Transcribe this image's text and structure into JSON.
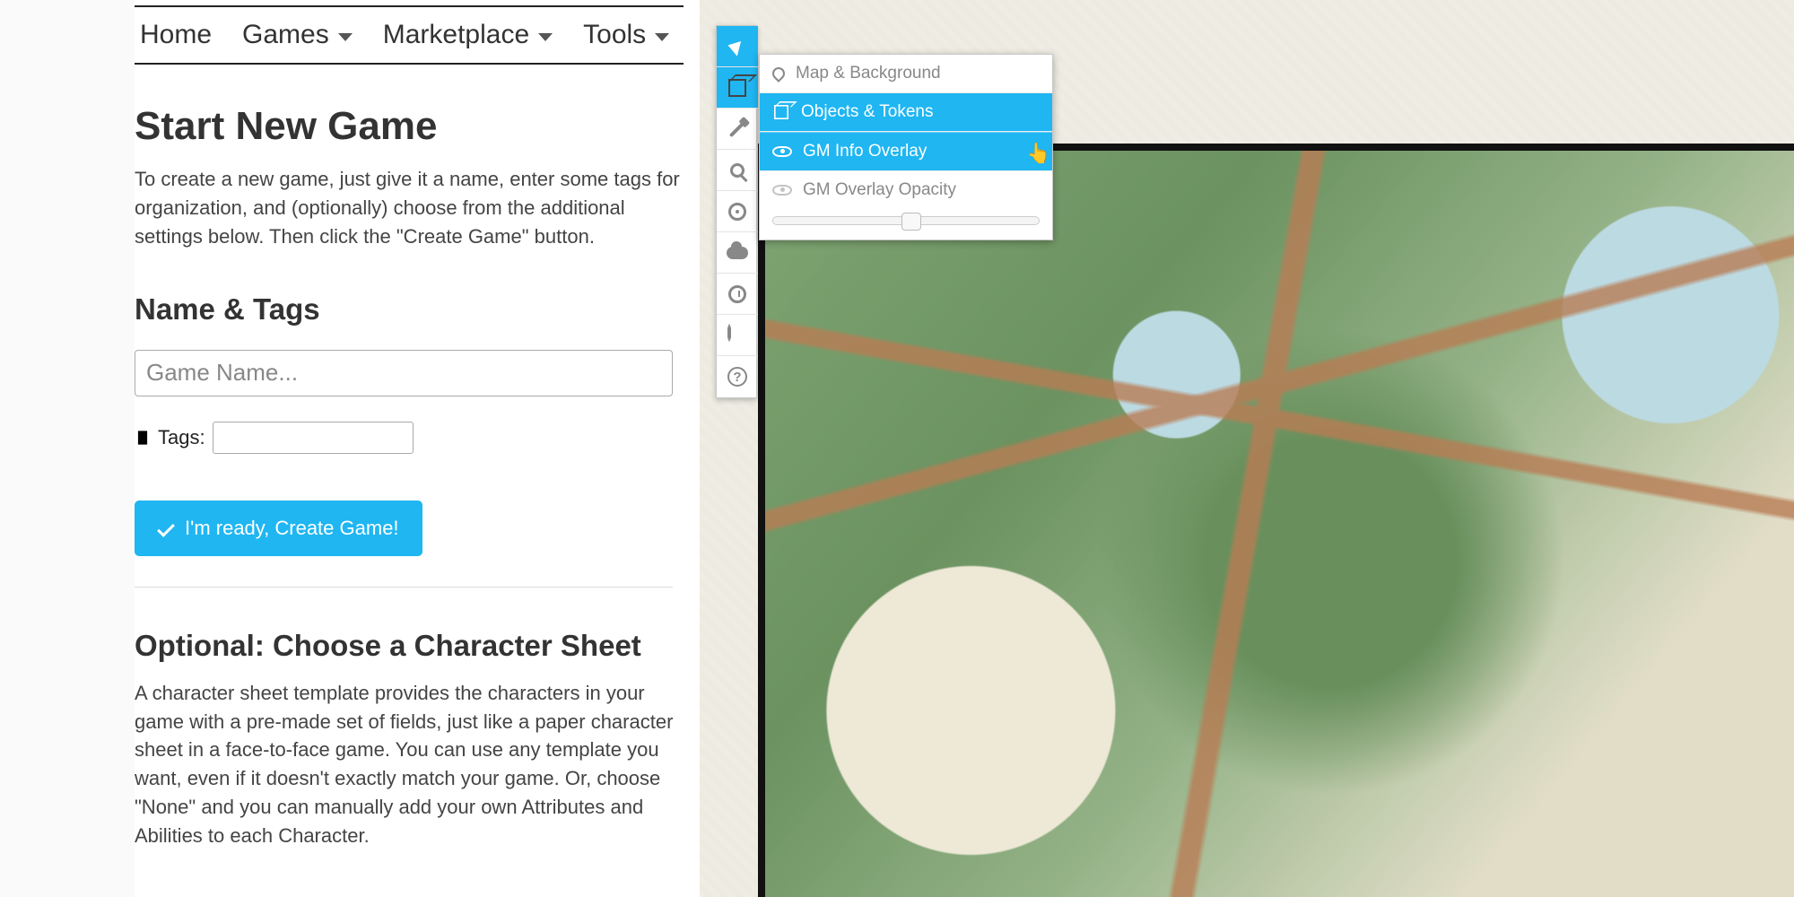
{
  "nav": {
    "items": [
      {
        "label": "Home",
        "has_dropdown": false
      },
      {
        "label": "Games",
        "has_dropdown": true
      },
      {
        "label": "Marketplace",
        "has_dropdown": true
      },
      {
        "label": "Tools",
        "has_dropdown": true
      }
    ]
  },
  "page": {
    "title": "Start New Game",
    "intro": "To create a new game, just give it a name, enter some tags for organization, and (optionally) choose from the additional settings below. Then click the \"Create Game\" button."
  },
  "form": {
    "name_tags_heading": "Name & Tags",
    "game_name_placeholder": "Game Name...",
    "game_name_value": "",
    "tags_label": "Tags:",
    "tags_value": "",
    "create_button": "I'm ready, Create Game!"
  },
  "sheet_section": {
    "heading": "Optional: Choose a Character Sheet",
    "desc": "A character sheet template provides the characters in your game with a pre-made set of fields, just like a paper character sheet in a face-to-face game. You can use any template you want, even if it doesn't exactly match your game. Or, choose \"None\" and you can manually add your own Attributes and Abilities to each Character."
  },
  "editor": {
    "toolbar": [
      {
        "name": "select-tool",
        "icon": "arrow",
        "active": true
      },
      {
        "name": "layers-tool",
        "icon": "cube",
        "active": true
      },
      {
        "name": "draw-tool",
        "icon": "brush",
        "active": false
      },
      {
        "name": "zoom-tool",
        "icon": "search",
        "active": false
      },
      {
        "name": "measure-tool",
        "icon": "target",
        "active": false
      },
      {
        "name": "fog-tool",
        "icon": "cloud",
        "active": false
      },
      {
        "name": "turn-tracker",
        "icon": "clock",
        "active": false
      },
      {
        "name": "dice-tool",
        "icon": "d20",
        "active": false
      },
      {
        "name": "help-tool",
        "icon": "help",
        "active": false
      }
    ],
    "flyout": {
      "items": [
        {
          "label": "Map & Background",
          "icon": "pin",
          "highlight": false
        },
        {
          "label": "Objects & Tokens",
          "icon": "cube",
          "highlight": true
        },
        {
          "label": "GM Info Overlay",
          "icon": "eye",
          "highlight": true
        }
      ],
      "opacity_label": "GM Overlay Opacity",
      "opacity_value_percent": 52
    }
  },
  "colors": {
    "accent": "#1fb6f2"
  }
}
